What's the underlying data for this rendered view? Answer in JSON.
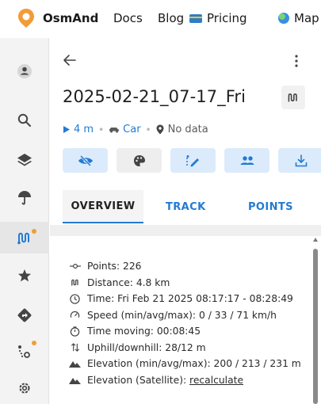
{
  "nav": {
    "brand": "OsmAnd",
    "links": [
      "Docs",
      "Blog",
      "Pricing",
      "Map"
    ],
    "logo_color": "#f29c38"
  },
  "sidebar": {
    "items": [
      {
        "icon": "user-icon"
      },
      {
        "icon": "search-icon"
      },
      {
        "icon": "layers-icon"
      },
      {
        "icon": "weather-umbrella-icon"
      },
      {
        "icon": "tracks-icon",
        "active": true,
        "badge": true
      },
      {
        "icon": "favorites-star-icon"
      },
      {
        "icon": "navigation-icon"
      },
      {
        "icon": "plan-route-icon",
        "badge": true
      },
      {
        "icon": "settings-gear-icon"
      }
    ],
    "badge_color": "#f29c38"
  },
  "panel": {
    "title": "2025-02-21_07-17_Fri",
    "meta": {
      "distance_short": "4 m",
      "profile": "Car",
      "status": "No data"
    },
    "tools": [
      "hide-icon",
      "color-palette-icon",
      "edit-track-icon",
      "share-users-icon",
      "download-icon"
    ],
    "tabs": {
      "overview": "OVERVIEW",
      "track": "TRACK",
      "points": "POINTS"
    },
    "info": {
      "points": "Points: 226",
      "distance": "Distance: 4.8 km",
      "time": "Time: Fri Feb 21 2025 08:17:17 - 08:28:49",
      "speed": "Speed (min/avg/max): 0 / 33 / 71 km/h",
      "time_moving": "Time moving: 00:08:45",
      "uphill": "Uphill/downhill: 28/12 m",
      "elevation": "Elevation (min/avg/max): 200 / 213 / 231 m",
      "elevation_sat_label": "Elevation (Satellite): ",
      "elevation_sat_link": "recalculate"
    }
  },
  "colors": {
    "accent": "#237bd3",
    "tool_blue_bg": "#dcebfb"
  }
}
